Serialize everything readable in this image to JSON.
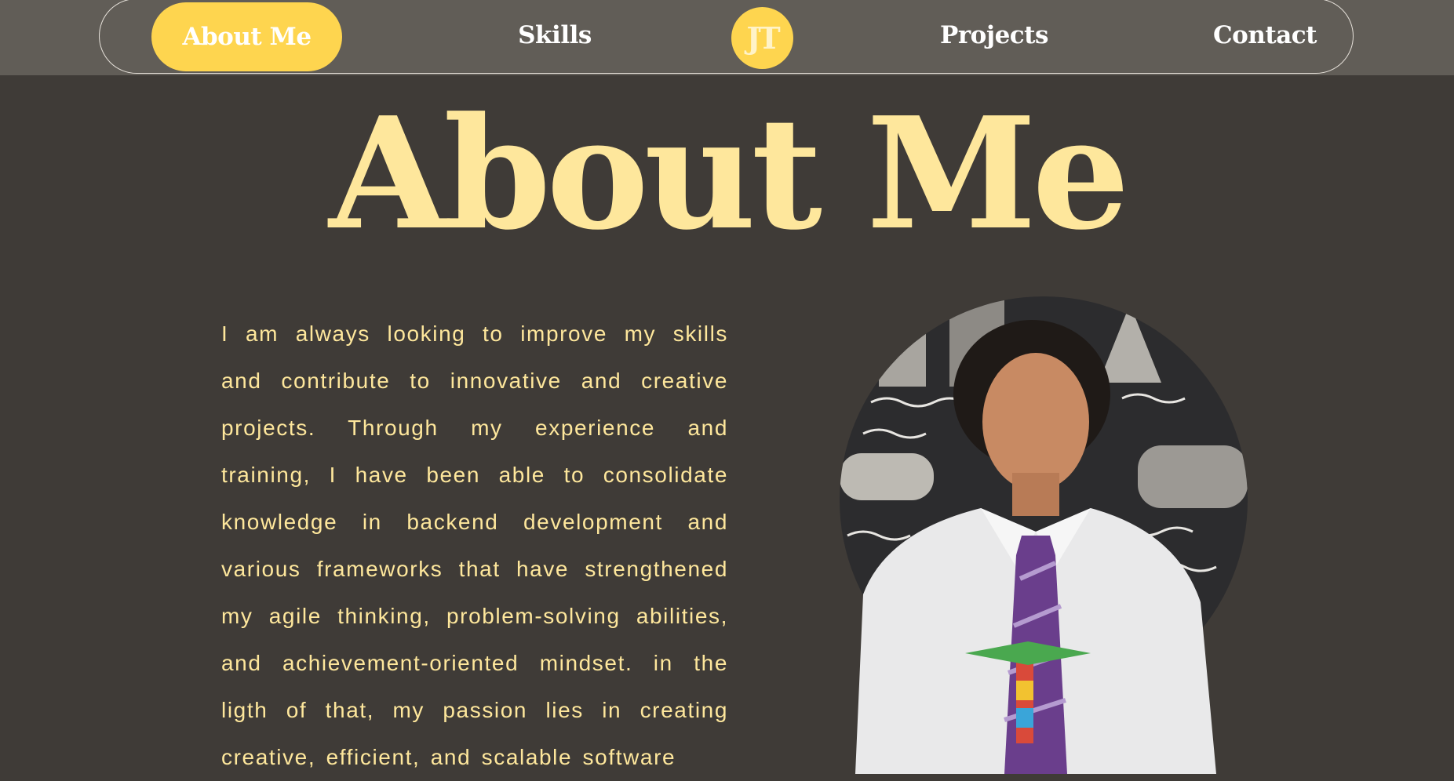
{
  "nav": {
    "items": [
      {
        "label": "About Me",
        "active": true
      },
      {
        "label": "Skills",
        "active": false
      },
      {
        "label": "Projects",
        "active": false
      },
      {
        "label": "Contact",
        "active": false
      }
    ],
    "logo": "JT"
  },
  "hero": {
    "title": "About Me"
  },
  "bio": {
    "text": "I am always looking to improve my skills and contribute to innovative and creative projects. Through my experience and training, I have been able to consolidate knowledge in backend development and various frameworks that have strengthened my agile thinking, problem-solving abilities, and achievement-oriented mindset. in the ligth of that, my passion lies in creating creative, efficient, and scalable software"
  },
  "colors": {
    "background": "#3f3b37",
    "topbar": "#615d57",
    "accent": "#fed54f",
    "title": "#fee79c",
    "nav_text": "#ffffff"
  }
}
